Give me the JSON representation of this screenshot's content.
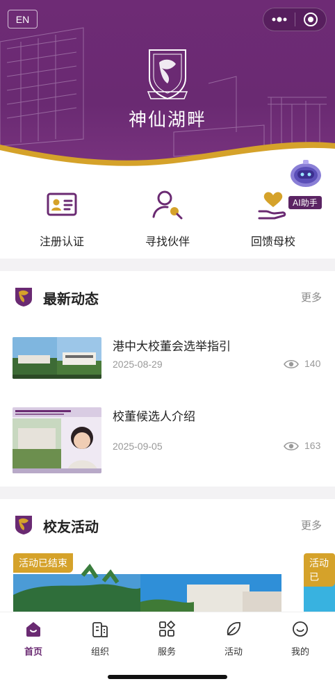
{
  "header": {
    "lang_button": "EN",
    "brand_title": "神仙湖畔"
  },
  "quick_actions": [
    {
      "label": "注册认证",
      "icon": "id-card-icon"
    },
    {
      "label": "寻找伙伴",
      "icon": "find-person-icon"
    },
    {
      "label": "回馈母校",
      "icon": "heart-hand-icon"
    }
  ],
  "ai_assistant": {
    "label": "AI助手",
    "icon": "robot-icon"
  },
  "news_section": {
    "title": "最新动态",
    "more": "更多",
    "items": [
      {
        "title": "港中大校董会选举指引",
        "date": "2025-08-29",
        "views": "140"
      },
      {
        "title": "校董候选人介绍",
        "date": "2025-09-05",
        "views": "163"
      }
    ]
  },
  "activity_section": {
    "title": "校友活动",
    "more": "更多",
    "cards": [
      {
        "status": "活动已结束"
      },
      {
        "status": "活动已"
      }
    ]
  },
  "tabbar": [
    {
      "label": "首页",
      "icon": "home-icon",
      "active": true
    },
    {
      "label": "组织",
      "icon": "building-icon",
      "active": false
    },
    {
      "label": "服务",
      "icon": "grid-icon",
      "active": false
    },
    {
      "label": "活动",
      "icon": "leaf-icon",
      "active": false
    },
    {
      "label": "我的",
      "icon": "smile-icon",
      "active": false
    }
  ],
  "colors": {
    "brand_purple": "#6a2a72",
    "gold": "#d5a22a",
    "ai_tag": "#5b2463"
  }
}
